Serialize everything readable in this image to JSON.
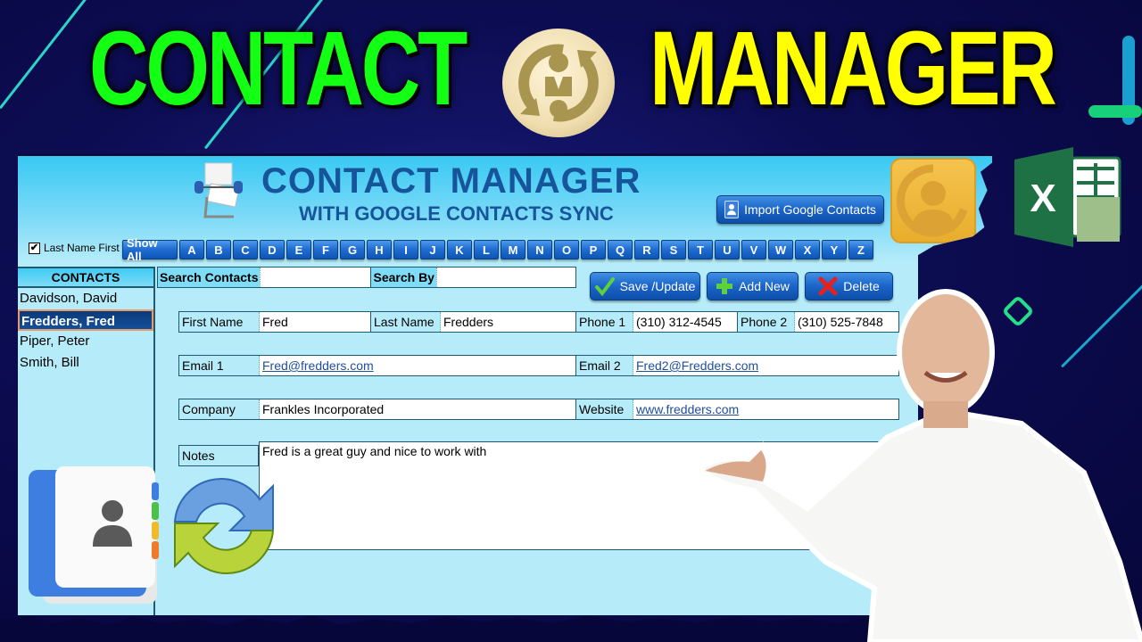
{
  "headline": {
    "word1": "CONTACT",
    "word2": "MANAGER",
    "word1_color": "#13ff13",
    "word2_color": "#ffff00"
  },
  "app": {
    "title": "CONTACT MANAGER",
    "subtitle": "WITH GOOGLE CONTACTS SYNC",
    "title_color": "#17559b",
    "import_button": "Import Google Contacts",
    "last_name_first": {
      "label": "Last Name First",
      "checked": true,
      "mark": "✔"
    },
    "alpha_filter": {
      "show_all": "Show All",
      "letters": [
        "A",
        "B",
        "C",
        "D",
        "E",
        "F",
        "G",
        "H",
        "I",
        "J",
        "K",
        "L",
        "M",
        "N",
        "O",
        "P",
        "Q",
        "R",
        "S",
        "T",
        "U",
        "V",
        "W",
        "X",
        "Y",
        "Z"
      ]
    },
    "contacts": {
      "header": "CONTACTS",
      "items": [
        "Davidson, David",
        "Fredders, Fred",
        "Piper, Peter",
        "Smith, Bill"
      ],
      "selected_index": 1
    },
    "search": {
      "search_contacts_label": "Search Contacts",
      "search_contacts_value": "",
      "search_by_label": "Search By",
      "search_by_value": ""
    },
    "actions": {
      "save": "Save /Update",
      "add": "Add New",
      "delete": "Delete"
    },
    "form": {
      "first_name_label": "First Name",
      "first_name": "Fred",
      "last_name_label": "Last Name",
      "last_name": "Fredders",
      "phone1_label": "Phone 1",
      "phone1": "(310) 312-4545",
      "phone2_label": "Phone 2",
      "phone2": "(310) 525-7848",
      "email1_label": "Email 1",
      "email1": "Fred@fredders.com",
      "email2_label": "Email 2",
      "email2": "Fred2@Fredders.com",
      "company_label": "Company",
      "company": "Frankles Incorporated",
      "website_label": "Website",
      "website": "www.fredders.com",
      "notes_label": "Notes",
      "notes": "Fred is a great guy and nice to work with"
    }
  },
  "icons": {
    "excel_letter": "X"
  }
}
